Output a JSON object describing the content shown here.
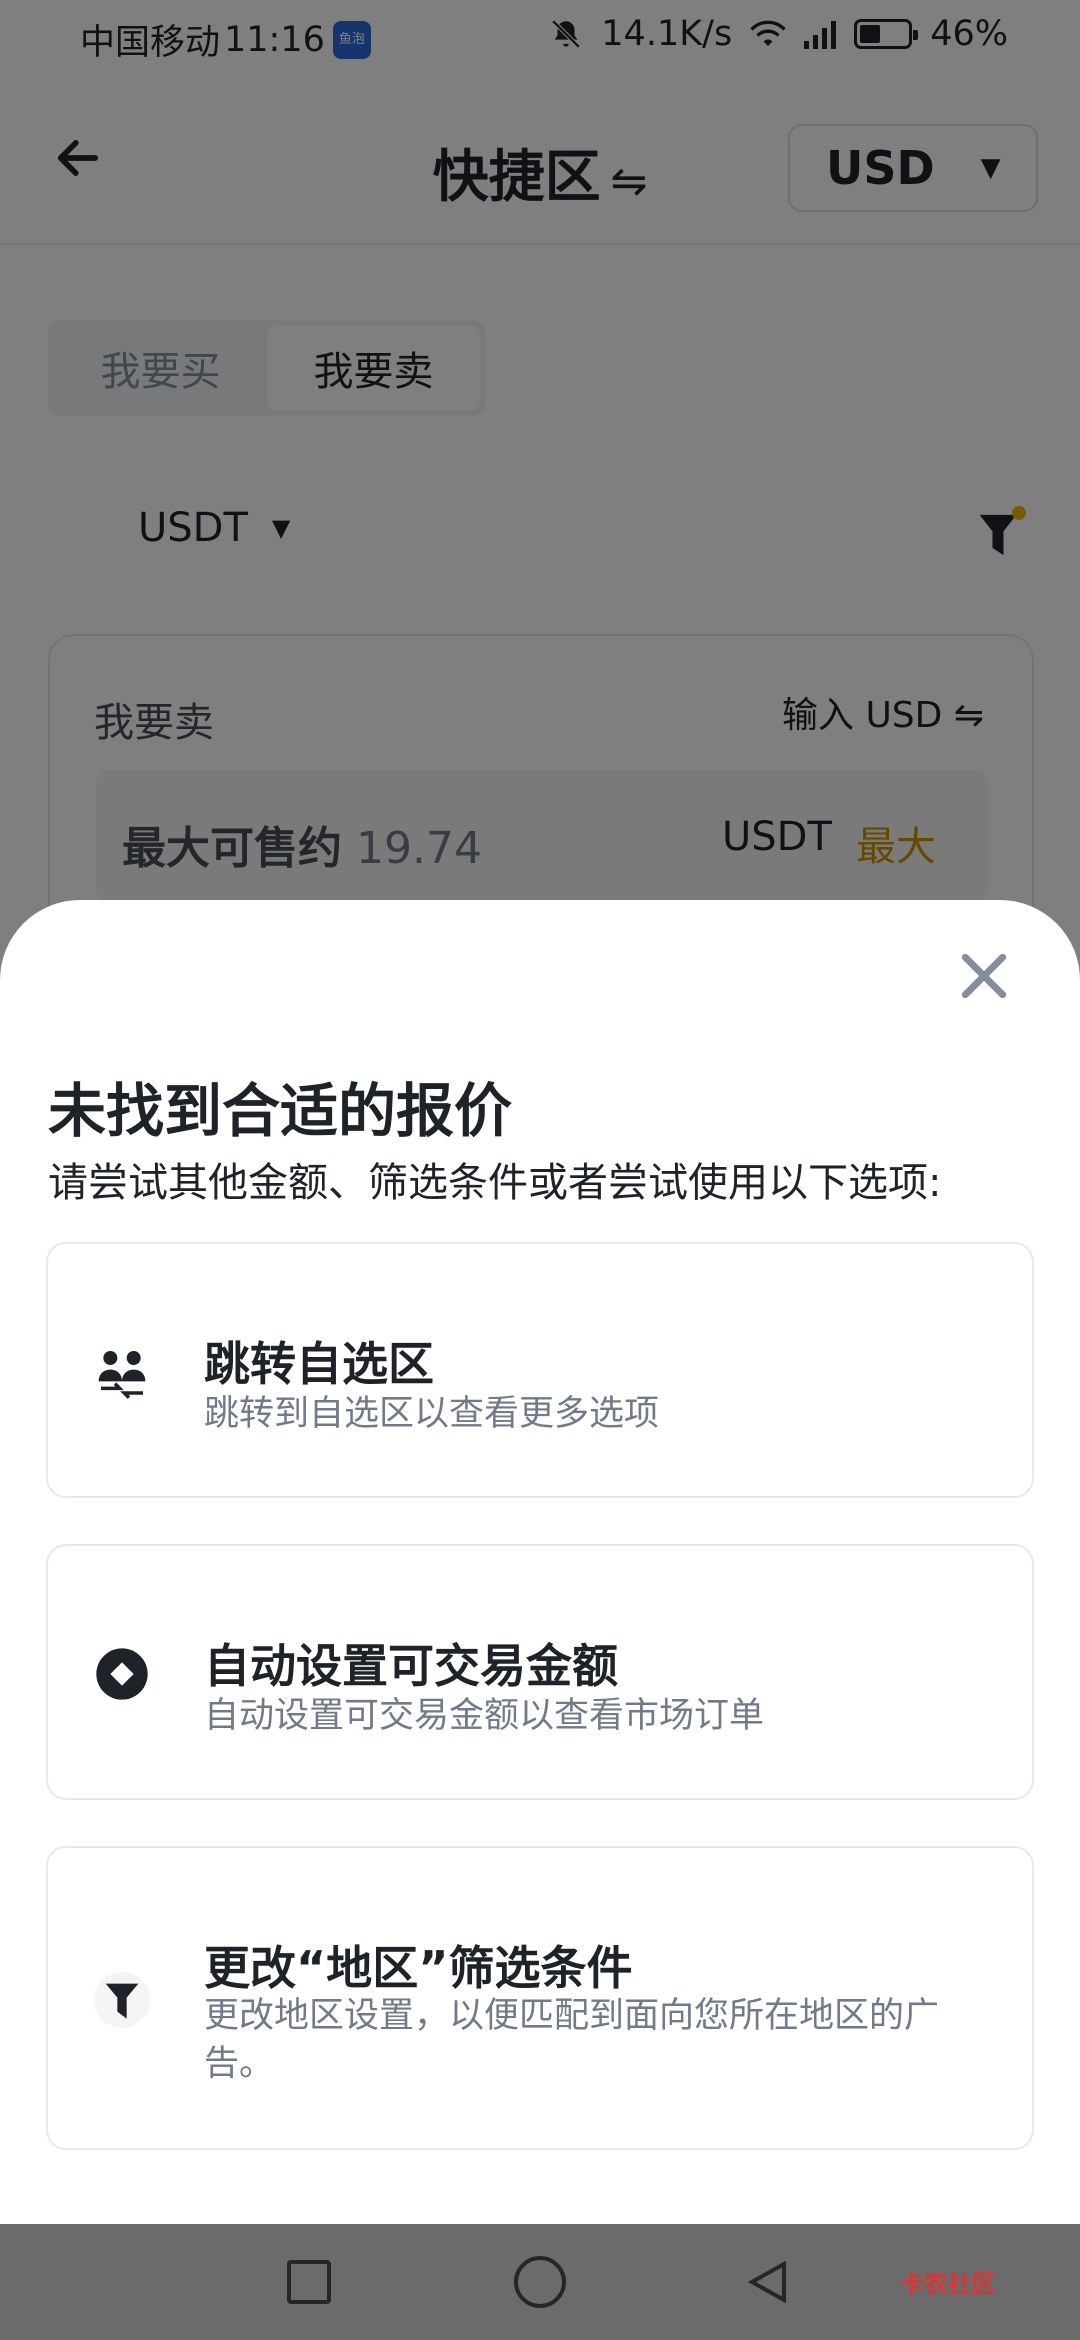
{
  "status_bar": {
    "carrier": "中国移动",
    "time": "11:16",
    "app_badge": "鱼泡",
    "net_speed": "14.1K/s",
    "battery": "46%"
  },
  "header": {
    "back_icon": "arrow-left-icon",
    "title": "快捷区",
    "title_switch_glyph": "⇋",
    "currency": "USD"
  },
  "tabs": [
    {
      "label": "我要买",
      "active": false
    },
    {
      "label": "我要卖",
      "active": true
    }
  ],
  "coin_selector": {
    "value": "USDT"
  },
  "sell_card": {
    "label": "我要卖",
    "input_mode": "输入 USD ⇋",
    "field_label": "最大可售约",
    "field_value": "19.74",
    "unit": "USDT",
    "max_label": "最大"
  },
  "sheet": {
    "title": "未找到合适的报价",
    "description": "请尝试其他金额、筛选条件或者尝试使用以下选项:",
    "options": [
      {
        "icon": "users-switch-icon",
        "title": "跳转自选区",
        "subtitle": "跳转到自选区以查看更多选项"
      },
      {
        "icon": "diamond-icon",
        "title": "自动设置可交易金额",
        "subtitle": "自动设置可交易金额以查看市场订单"
      },
      {
        "icon": "filter-icon",
        "title": "更改“地区”筛选条件",
        "subtitle": "更改地区设置，以便匹配到面向您所在地区的广告。"
      }
    ]
  },
  "watermark": "卡农社区",
  "colors": {
    "accent": "#f0b90b",
    "max": "#c99400",
    "text": "#1e2329",
    "muted": "#707a8a"
  }
}
